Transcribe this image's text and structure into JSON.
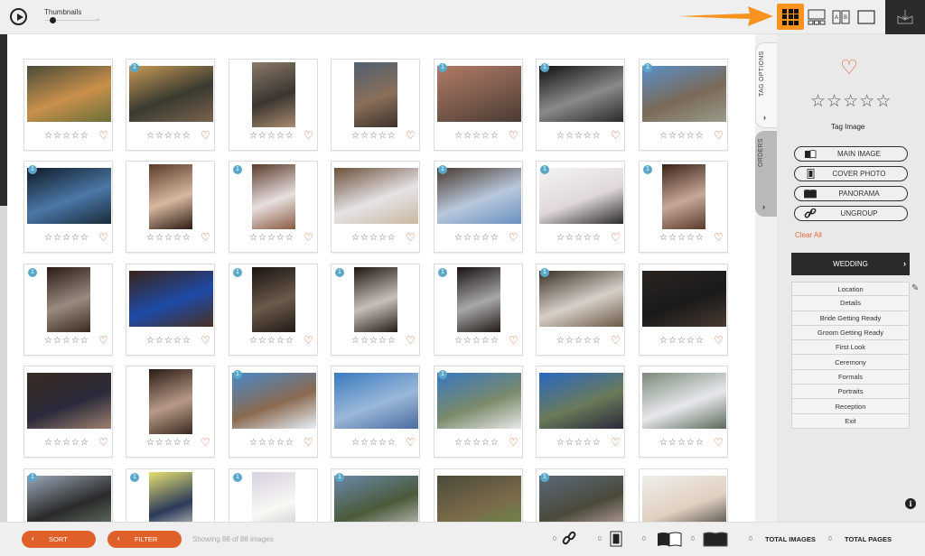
{
  "topbar": {
    "thumbnails_label": "Thumbnails",
    "thumbnail_size": 0.1,
    "view_modes": [
      {
        "name": "grid",
        "icon": "grid-icon",
        "active": true
      },
      {
        "name": "filmstrip",
        "icon": "filmstrip-icon",
        "active": false
      },
      {
        "name": "compare",
        "icon": "compare-ab-icon",
        "active": false,
        "labels": [
          "A",
          "B"
        ]
      },
      {
        "name": "single",
        "icon": "single-view-icon",
        "active": false
      }
    ],
    "accent": "#f7931e"
  },
  "grid": {
    "cards": [
      {
        "badge": "",
        "colors": [
          "#4a4b3a",
          "#c9904a",
          "#6b6e3a"
        ],
        "orient": "landscape",
        "rating": 0,
        "favorite": false
      },
      {
        "badge": "1",
        "colors": [
          "#c79a56",
          "#3a3a30",
          "#7a6250"
        ],
        "orient": "landscape",
        "rating": 0,
        "favorite": false
      },
      {
        "badge": "",
        "colors": [
          "#8a7a6a",
          "#3b3530",
          "#a88c70"
        ],
        "orient": "portrait",
        "rating": 0,
        "favorite": false
      },
      {
        "badge": "",
        "colors": [
          "#506070",
          "#8a6f5a",
          "#3c332c"
        ],
        "orient": "portrait",
        "rating": 0,
        "favorite": false
      },
      {
        "badge": "1",
        "colors": [
          "#b07a64",
          "#7a5a4c",
          "#4a3a32"
        ],
        "orient": "landscape",
        "rating": 0,
        "favorite": false
      },
      {
        "badge": "1",
        "colors": [
          "#111111",
          "#8a8a8a",
          "#2a2a2a"
        ],
        "orient": "landscape",
        "rating": 0,
        "favorite": false
      },
      {
        "badge": "1",
        "colors": [
          "#5a8fc8",
          "#7a6a58",
          "#9a9a8a"
        ],
        "orient": "landscape",
        "rating": 0,
        "favorite": false
      },
      {
        "badge": "1",
        "colors": [
          "#111a26",
          "#4a78a8",
          "#1a2a3a"
        ],
        "orient": "landscape",
        "rating": 0,
        "favorite": false
      },
      {
        "badge": "",
        "colors": [
          "#5a3a2a",
          "#d9b8a0",
          "#2a1a14"
        ],
        "orient": "portrait",
        "rating": 0,
        "favorite": false
      },
      {
        "badge": "1",
        "colors": [
          "#5a3a2a",
          "#e8e0e0",
          "#8a5a40"
        ],
        "orient": "portrait",
        "rating": 0,
        "favorite": false
      },
      {
        "badge": "",
        "colors": [
          "#6a5038",
          "#e6e2e6",
          "#c8b8a0"
        ],
        "orient": "landscape",
        "rating": 0,
        "favorite": false
      },
      {
        "badge": "1",
        "colors": [
          "#4a3a30",
          "#b8c8dc",
          "#6a90c0"
        ],
        "orient": "landscape",
        "rating": 0,
        "favorite": false
      },
      {
        "badge": "1",
        "colors": [
          "#f4f4f4",
          "#e0d8d8",
          "#2a2a2a"
        ],
        "orient": "landscape",
        "rating": 0,
        "favorite": false
      },
      {
        "badge": "1",
        "colors": [
          "#3a2218",
          "#c8a898",
          "#5a3a2a"
        ],
        "orient": "portrait",
        "rating": 0,
        "favorite": false
      },
      {
        "badge": "1",
        "colors": [
          "#2a1a14",
          "#9a8a80",
          "#3a2a20"
        ],
        "orient": "portrait",
        "rating": 0,
        "favorite": false
      },
      {
        "badge": "",
        "colors": [
          "#3a2418",
          "#1e4aa8",
          "#4a3020"
        ],
        "orient": "landscape",
        "rating": 0,
        "favorite": false
      },
      {
        "badge": "1",
        "colors": [
          "#1a1412",
          "#6a5a4a",
          "#221a16"
        ],
        "orient": "portrait",
        "rating": 0,
        "favorite": false
      },
      {
        "badge": "1",
        "colors": [
          "#1e1612",
          "#c8c0b8",
          "#261c18"
        ],
        "orient": "portrait",
        "rating": 0,
        "favorite": false
      },
      {
        "badge": "1",
        "colors": [
          "#181210",
          "#a8a8a8",
          "#221a16"
        ],
        "orient": "portrait",
        "rating": 0,
        "favorite": false
      },
      {
        "badge": "1",
        "colors": [
          "#3a3028",
          "#d8d0c8",
          "#6a5a48"
        ],
        "orient": "landscape",
        "rating": 0,
        "favorite": false
      },
      {
        "badge": "",
        "colors": [
          "#2a2420",
          "#1a1a1a",
          "#4a3a30"
        ],
        "orient": "landscape",
        "rating": 0,
        "favorite": false
      },
      {
        "badge": "",
        "colors": [
          "#3a2a22",
          "#2a2a3a",
          "#a08070"
        ],
        "orient": "landscape",
        "rating": 0,
        "favorite": false
      },
      {
        "badge": "",
        "colors": [
          "#2a1a14",
          "#b89a88",
          "#3a2a20"
        ],
        "orient": "portrait",
        "rating": 0,
        "favorite": false
      },
      {
        "badge": "1",
        "colors": [
          "#4a88c8",
          "#8a6a50",
          "#e8f0f8"
        ],
        "orient": "landscape",
        "rating": 0,
        "favorite": false
      },
      {
        "badge": "",
        "colors": [
          "#3a7ac0",
          "#9ab8d8",
          "#4a6aa0"
        ],
        "orient": "landscape",
        "rating": 0,
        "favorite": false
      },
      {
        "badge": "1",
        "colors": [
          "#3a78c0",
          "#7a8a6a",
          "#e8e8e8"
        ],
        "orient": "landscape",
        "rating": 0,
        "favorite": false
      },
      {
        "badge": "",
        "colors": [
          "#2a68c0",
          "#6a7a5a",
          "#2a2a3a"
        ],
        "orient": "landscape",
        "rating": 0,
        "favorite": false
      },
      {
        "badge": "",
        "colors": [
          "#7a8a7a",
          "#e8e8ec",
          "#5a6a5a"
        ],
        "orient": "landscape",
        "rating": 0,
        "favorite": false
      },
      {
        "badge": "1",
        "colors": [
          "#9aa8b8",
          "#2a2a2a",
          "#6a7a6a"
        ],
        "orient": "landscape",
        "rating": 0,
        "favorite": false
      },
      {
        "badge": "1",
        "colors": [
          "#e8e070",
          "#2a3a5a",
          "#f0e8d8"
        ],
        "orient": "portrait",
        "rating": 0,
        "favorite": false
      },
      {
        "badge": "1",
        "colors": [
          "#d8d0e0",
          "#f8f8f4",
          "#c8c0d0"
        ],
        "orient": "portrait",
        "rating": 0,
        "favorite": false
      },
      {
        "badge": "1",
        "colors": [
          "#6a88a8",
          "#4a5a3a",
          "#c8c8c8"
        ],
        "orient": "landscape",
        "rating": 0,
        "favorite": false
      },
      {
        "badge": "",
        "colors": [
          "#4a4a3a",
          "#7a6a4a",
          "#6a8a4a"
        ],
        "orient": "landscape",
        "rating": 0,
        "favorite": false
      },
      {
        "badge": "1",
        "colors": [
          "#5a6a7a",
          "#4a4a3a",
          "#c8a8a8"
        ],
        "orient": "landscape",
        "rating": 0,
        "favorite": false
      },
      {
        "badge": "",
        "colors": [
          "#f0eeea",
          "#e0d0c0",
          "#3a3a3a"
        ],
        "orient": "landscape",
        "rating": 0,
        "favorite": false
      }
    ]
  },
  "sidebar": {
    "tabs": [
      {
        "label": "TAG OPTIONS",
        "active": true
      },
      {
        "label": "ORDERS",
        "active": false
      }
    ],
    "tag_image_label": "Tag Image",
    "rating": 0,
    "actions": [
      {
        "label": "MAIN IMAGE",
        "icon": "open-book-icon"
      },
      {
        "label": "COVER PHOTO",
        "icon": "cover-photo-icon"
      },
      {
        "label": "PANORAMA",
        "icon": "panorama-book-icon"
      },
      {
        "label": "UNGROUP",
        "icon": "link-icon"
      }
    ],
    "clear_all": "Clear All",
    "category": "WEDDING",
    "menu": [
      "Location",
      "Details",
      "Bride Getting Ready",
      "Groom Getting Ready",
      "First Look",
      "Ceremony",
      "Formals",
      "Portraits",
      "Reception",
      "Exit"
    ],
    "accent": "#e0653a"
  },
  "bottombar": {
    "sort_label": "SORT",
    "filter_label": "FILTER",
    "showing": "Showing 88 of 88 images",
    "stats": {
      "ungroup_count": "0",
      "cover_count": "0",
      "main_count": "0",
      "panorama_count": "0",
      "total_images_count": "0",
      "total_images_label": "TOTAL IMAGES",
      "total_pages_count": "0",
      "total_pages_label": "TOTAL PAGES"
    },
    "button_color": "#e0602a"
  }
}
